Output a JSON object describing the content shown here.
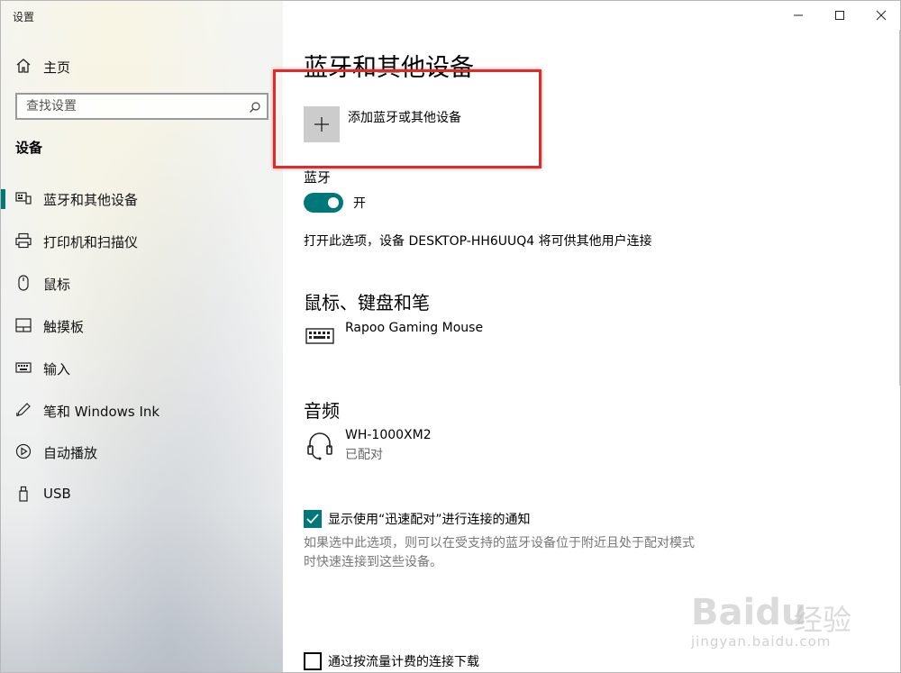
{
  "window": {
    "title": "设置"
  },
  "sidebar": {
    "home_label": "主页",
    "search_placeholder": "查找设置",
    "section_title": "设备",
    "items": [
      {
        "label": "蓝牙和其他设备",
        "icon": "bluetooth-devices-icon",
        "selected": true
      },
      {
        "label": "打印机和扫描仪",
        "icon": "printer-icon",
        "selected": false
      },
      {
        "label": "鼠标",
        "icon": "mouse-icon",
        "selected": false
      },
      {
        "label": "触摸板",
        "icon": "touchpad-icon",
        "selected": false
      },
      {
        "label": "输入",
        "icon": "keyboard-icon",
        "selected": false
      },
      {
        "label": "笔和 Windows Ink",
        "icon": "pen-icon",
        "selected": false
      },
      {
        "label": "自动播放",
        "icon": "autoplay-icon",
        "selected": false
      },
      {
        "label": "USB",
        "icon": "usb-icon",
        "selected": false
      }
    ]
  },
  "main": {
    "title": "蓝牙和其他设备",
    "add_device_label": "添加蓝牙或其他设备",
    "bluetooth": {
      "label": "蓝牙",
      "state": "开",
      "on": true,
      "description": "打开此选项，设备 DESKTOP-HH6UUQ4 将可供其他用户连接"
    },
    "groups": [
      {
        "title": "鼠标、键盘和笔",
        "devices": [
          {
            "name": "Rapoo Gaming Mouse",
            "status": "",
            "icon": "keyboard-icon"
          }
        ]
      },
      {
        "title": "音频",
        "devices": [
          {
            "name": "WH-1000XM2",
            "status": "已配对",
            "icon": "headset-icon"
          }
        ]
      }
    ],
    "swift_pair": {
      "checked": true,
      "label": "显示使用“迅速配对”进行连接的通知",
      "help": "如果选中此选项，则可以在受支持的蓝牙设备位于附近且处于配对模式时快速连接到这些设备。"
    },
    "metered": {
      "checked": false,
      "label": "通过按流量计费的连接下载"
    }
  },
  "watermark": {
    "logo": "Baidu",
    "suffix": "经验",
    "url": "jingyan.baidu.com"
  },
  "colors": {
    "accent": "#00787a",
    "highlight_border": "#e02a2a"
  }
}
